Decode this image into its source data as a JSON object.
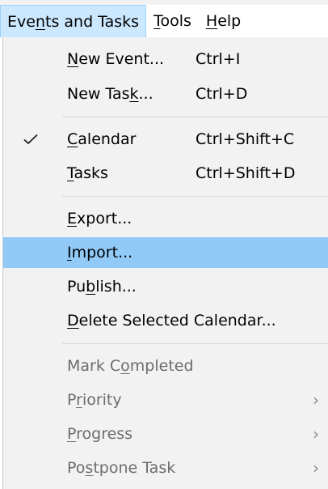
{
  "menubar": {
    "items": [
      {
        "pre": "Eve",
        "mnemonic": "n",
        "post": "ts and Tasks",
        "open": true
      },
      {
        "pre": "",
        "mnemonic": "T",
        "post": "ools",
        "open": false
      },
      {
        "pre": "",
        "mnemonic": "H",
        "post": "elp",
        "open": false
      }
    ]
  },
  "menu": {
    "items": [
      {
        "pre": "",
        "mnemonic": "N",
        "post": "ew Event...",
        "shortcut": "Ctrl+I"
      },
      {
        "pre": "New Tas",
        "mnemonic": "k",
        "post": "...",
        "shortcut": "Ctrl+D"
      },
      {
        "pre": "",
        "mnemonic": "C",
        "post": "alendar",
        "shortcut": "Ctrl+Shift+C",
        "checked": true
      },
      {
        "pre": "",
        "mnemonic": "T",
        "post": "asks",
        "shortcut": "Ctrl+Shift+D"
      },
      {
        "pre": "",
        "mnemonic": "E",
        "post": "xport..."
      },
      {
        "pre": "",
        "mnemonic": "I",
        "post": "mport...",
        "highlighted": true
      },
      {
        "pre": "Pu",
        "mnemonic": "b",
        "post": "lish..."
      },
      {
        "pre": "",
        "mnemonic": "D",
        "post": "elete Selected Calendar..."
      },
      {
        "pre": "Mark C",
        "mnemonic": "o",
        "post": "mpleted",
        "disabled": true
      },
      {
        "pre": "P",
        "mnemonic": "r",
        "post": "iority",
        "disabled": true,
        "submenu": true
      },
      {
        "pre": "",
        "mnemonic": "P",
        "post": "rogress",
        "disabled": true,
        "submenu": true
      },
      {
        "pre": "Po",
        "mnemonic": "s",
        "post": "tpone Task",
        "disabled": true,
        "submenu": true
      }
    ]
  },
  "colors": {
    "highlight": "#91c9f7",
    "open_menu": "#cce8ff",
    "disabled_text": "#6d6d6d"
  },
  "icons": {
    "check": "check-icon",
    "submenu": "chevron-right-icon"
  }
}
